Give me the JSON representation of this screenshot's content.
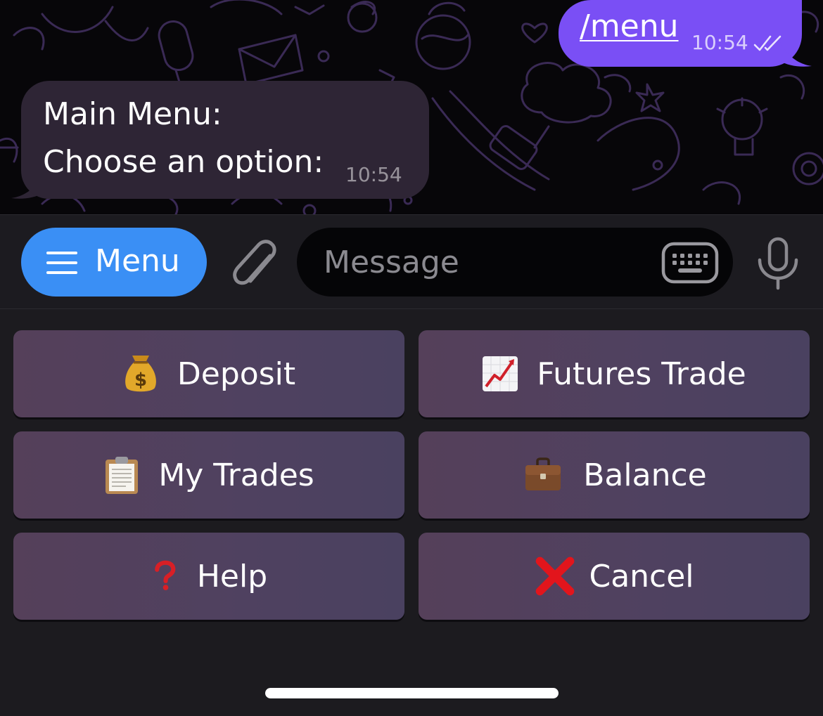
{
  "chat": {
    "outgoing": {
      "text": "/menu",
      "time": "10:54",
      "status_icon": "double-check-icon"
    },
    "incoming": {
      "line1": "Main Menu:",
      "line2": "Choose an option:",
      "time": "10:54"
    }
  },
  "input_bar": {
    "menu_label": "Menu",
    "menu_icon": "hamburger-icon",
    "attach_icon": "paperclip-icon",
    "message_placeholder": "Message",
    "message_value": "",
    "keyboard_icon": "keyboard-icon",
    "mic_icon": "microphone-icon"
  },
  "keyboard": {
    "buttons": [
      {
        "label": "Deposit",
        "icon": "money-bag-icon"
      },
      {
        "label": "Futures Trade",
        "icon": "chart-increasing-icon"
      },
      {
        "label": "My Trades",
        "icon": "clipboard-icon"
      },
      {
        "label": "Balance",
        "icon": "briefcase-icon"
      },
      {
        "label": "Help",
        "icon": "question-mark-icon"
      },
      {
        "label": "Cancel",
        "icon": "cross-mark-icon"
      }
    ]
  },
  "colors": {
    "outgoing_bubble": "#7a4ff5",
    "incoming_bubble": "#2e2535",
    "menu_button": "#3a8ff5",
    "chat_background": "#070609",
    "keyboard_button": "#55405a"
  }
}
